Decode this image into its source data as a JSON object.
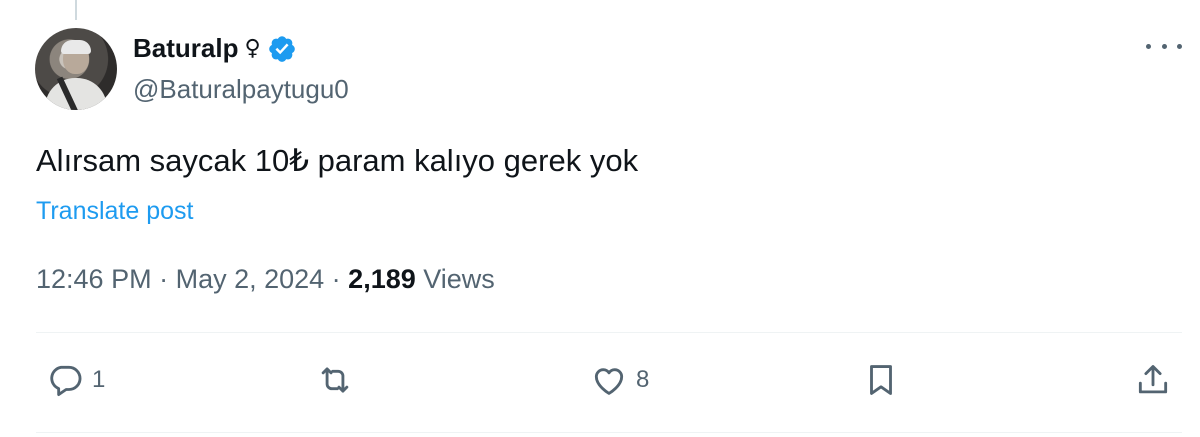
{
  "author": {
    "display_name": "Baturalp",
    "gender_symbol": "♀",
    "handle": "@Baturalpaytugu0",
    "verified": true
  },
  "post": {
    "text": "Alırsam saycak 10₺ param kalıyo gerek yok",
    "translate_label": "Translate post"
  },
  "meta": {
    "time": "12:46 PM",
    "separator": " · ",
    "date": "May 2, 2024",
    "views_count": "2,189",
    "views_label": "Views"
  },
  "actions": {
    "reply_count": "1",
    "repost_count": "",
    "like_count": "8"
  },
  "colors": {
    "accent": "#1d9bf0",
    "muted": "#536471",
    "text": "#0f1419"
  },
  "icons": {
    "more": "more-horizontal-icon",
    "verified": "verified-badge-icon",
    "reply": "reply-icon",
    "repost": "repost-icon",
    "like": "heart-icon",
    "bookmark": "bookmark-icon",
    "share": "share-icon"
  }
}
